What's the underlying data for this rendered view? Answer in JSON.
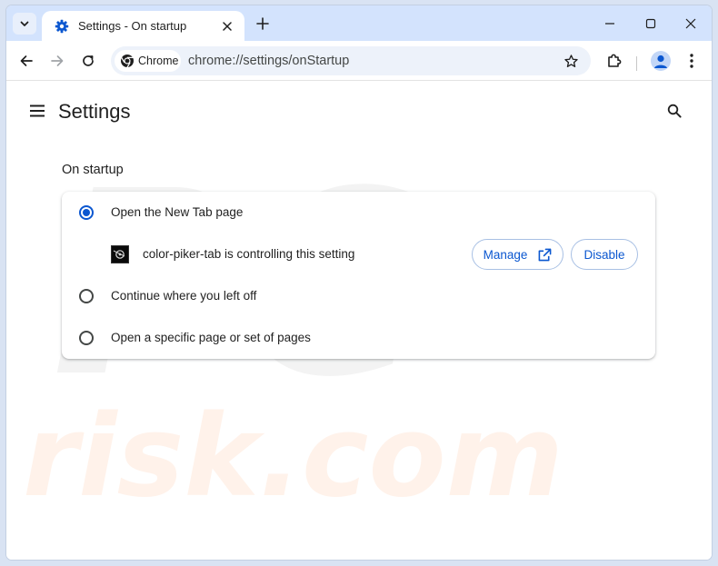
{
  "tab": {
    "title": "Settings - On startup"
  },
  "toolbar": {
    "chip_label": "Chrome",
    "url": "chrome://settings/onStartup"
  },
  "page": {
    "title": "Settings"
  },
  "startup": {
    "section_title": "On startup",
    "options": [
      {
        "label": "Open the New Tab page",
        "checked": true
      },
      {
        "label": "Continue where you left off",
        "checked": false
      },
      {
        "label": "Open a specific page or set of pages",
        "checked": false
      }
    ],
    "extension": {
      "message": "color-piker-tab is controlling this setting",
      "manage_label": "Manage",
      "disable_label": "Disable"
    }
  },
  "watermark": {
    "line1": "PC",
    "line2": "risk.com"
  },
  "colors": {
    "accent": "#0b57d0",
    "tabstrip": "#d3e3fd",
    "omnibox": "#edf2fa",
    "icon": "#444746"
  }
}
